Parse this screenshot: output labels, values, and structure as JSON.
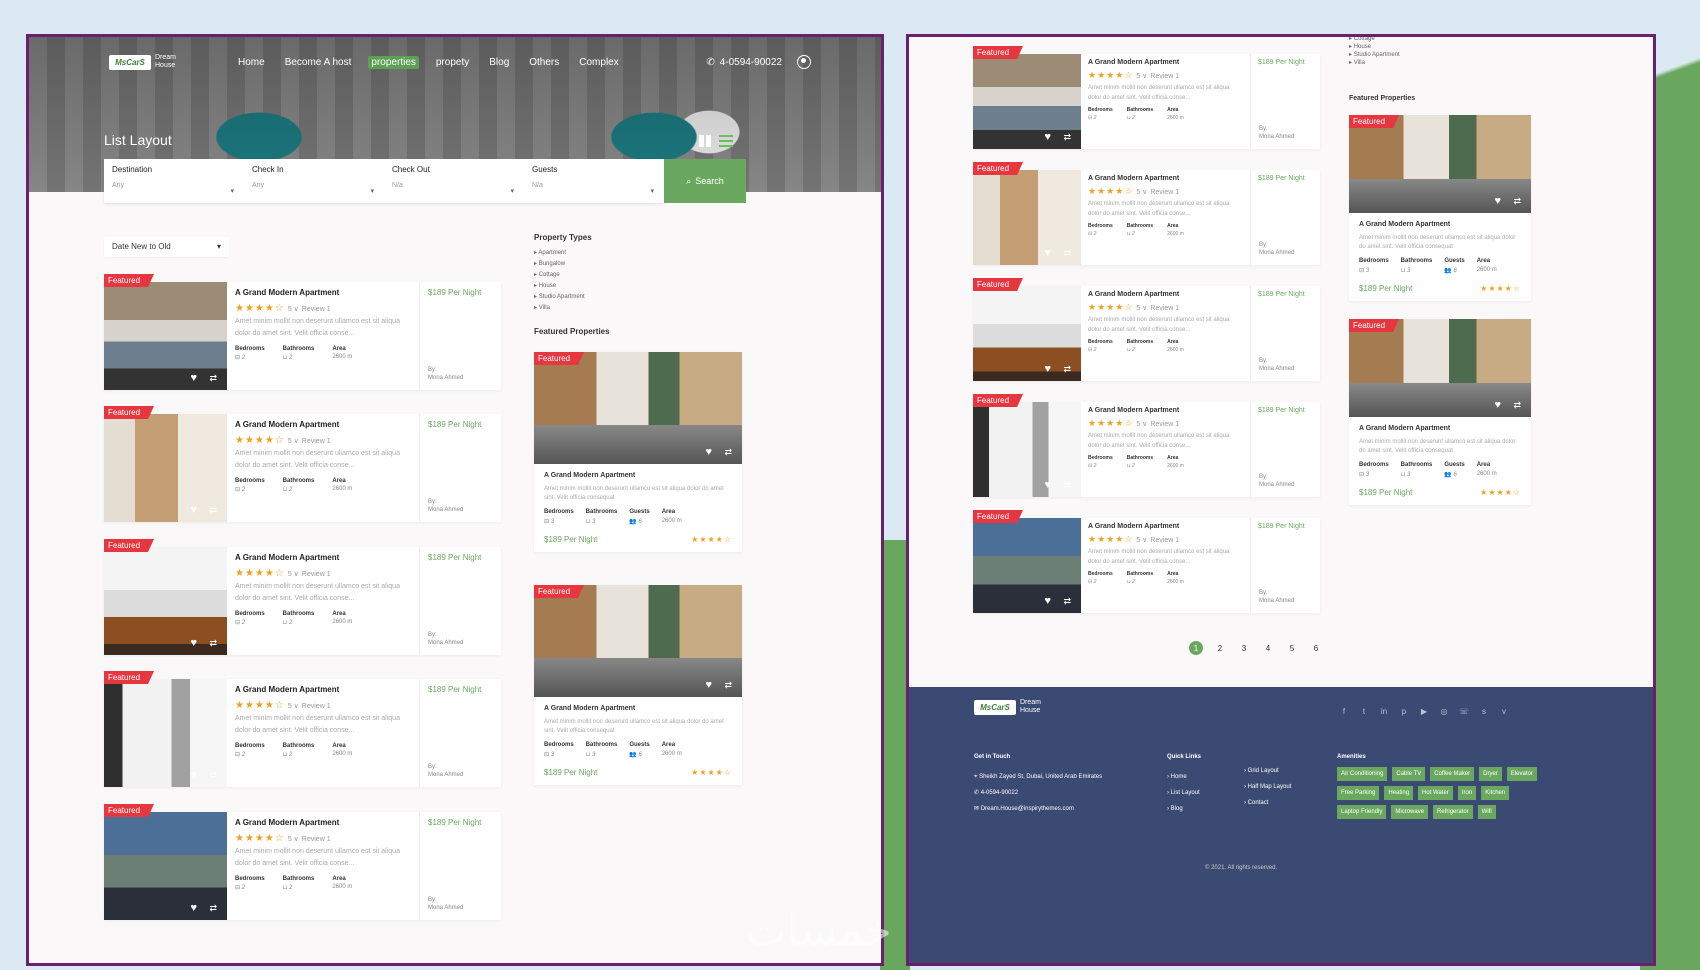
{
  "brand": {
    "logo": "MsCarS",
    "name": "Dream House"
  },
  "nav": {
    "items": [
      "Home",
      "Become A host",
      "properties",
      "propety",
      "Blog",
      "Others",
      "Complex"
    ],
    "active": "properties",
    "phone": "4-0594-90022"
  },
  "hero": {
    "title": "List Layout"
  },
  "search": {
    "fields": [
      {
        "label": "Destination",
        "value": "Any"
      },
      {
        "label": "Check In",
        "value": "Any"
      },
      {
        "label": "Check Out",
        "value": "N/a"
      },
      {
        "label": "Guests",
        "value": "N/a"
      }
    ],
    "button": "Search"
  },
  "sort": {
    "value": "Date New to Old"
  },
  "listing": {
    "badge": "Featured",
    "title": "A Grand Modern Apartment",
    "stars": "★★★★☆",
    "rating": "5 ∨",
    "reviews": "Review 1",
    "desc": "Amet minim mollit non deserunt ullamco est sit aliqua dolor do amet sint. Velit officia conse...",
    "price": "$189 Per Night",
    "by": "By:",
    "agent": "Mona Ahmed",
    "bed_label": "Bedrooms",
    "bed": "2",
    "bath_label": "Bathrooms",
    "bath": "2",
    "area_label": "Area",
    "area": "2600 m"
  },
  "sidebar": {
    "types_title": "Property Types",
    "types": [
      "Apartment",
      "Bungalow",
      "Cottage",
      "House",
      "Studio Apartment",
      "Villa"
    ],
    "featured_title": "Featured Properties"
  },
  "featured": {
    "badge": "Featured",
    "title": "A Grand Modern Apartment",
    "desc": "Amet minim mollit non deserunt ullamco est sit aliqua dolor do amet sint. Velit officia consequat",
    "bed_label": "Bedrooms",
    "bed": "3",
    "bath_label": "Bathrooms",
    "bath": "3",
    "guests_label": "Guests",
    "guests": "6",
    "area_label": "Area",
    "area": "2600 m",
    "price": "$189 Per Night",
    "stars": "★★★★☆"
  },
  "pagination": [
    "1",
    "2",
    "3",
    "4",
    "5",
    "6"
  ],
  "footer": {
    "get_in_touch": "Get in Touch",
    "address": "Sheikh Zayed St, Dubai, United Arab Emirates",
    "phone": "4-0594-90022",
    "email": "Dream.House@inspirythemes.com",
    "quick_links_title": "Quick Links",
    "links_a": [
      "Home",
      "List Layout",
      "Blog"
    ],
    "links_b": [
      "Grid Layout",
      "Half Map Layout",
      "Contact"
    ],
    "amenities_title": "Amenities",
    "amenities": [
      "Air Conditioning",
      "Cable TV",
      "Coffee Maker",
      "Dryer",
      "Elevator",
      "Free Parking",
      "Heating",
      "Hot Water",
      "Iron",
      "Kitchen",
      "Laptop Friendly",
      "Microwave",
      "Refrigerator",
      "Wifi"
    ],
    "copyright": "© 2021. All rights reserved."
  },
  "watermark": "خمسات"
}
